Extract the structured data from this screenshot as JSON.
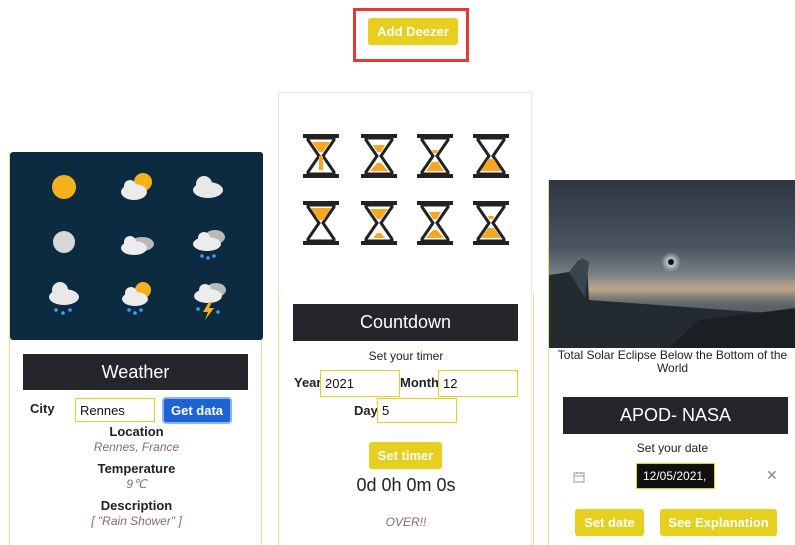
{
  "header": {
    "add_deezer_label": "Add Deezer"
  },
  "weather": {
    "title": "Weather",
    "city_label": "City",
    "city_value": "Rennes",
    "get_data_label": "Get data",
    "location_label": "Location",
    "location_value": "Rennes, France",
    "temperature_label": "Temperature",
    "temperature_value": "9℃",
    "description_label": "Description",
    "description_value": "[ \"Rain Shower\" ]",
    "icons": [
      "sun-icon",
      "partly-cloudy-icon",
      "cloud-icon",
      "moon-icon",
      "cloudy-icon",
      "cloud-rain-icon",
      "rain-icon",
      "sun-rain-icon",
      "thunderstorm-icon"
    ]
  },
  "countdown": {
    "title": "Countdown",
    "subtitle": "Set your timer",
    "year_label": "Year",
    "year_value": "2021",
    "month_label": "Month",
    "month_value": "12",
    "day_label": "Day",
    "day_value": "5",
    "set_timer_label": "Set timer",
    "timer_value": "0d 0h 0m 0s",
    "status": "OVER!!"
  },
  "apod": {
    "caption": "Total Solar Eclipse Below the Bottom of the World",
    "title": "APOD- NASA",
    "set_date_label": "Set your date",
    "date_value": "12/05/2021,",
    "set_date_button": "Set date",
    "see_explanation_button": "See Explanation"
  },
  "colors": {
    "accent": "#e6cf1f",
    "dark": "#24262b",
    "primary": "#1c64d4",
    "highlight": "#e53935"
  }
}
